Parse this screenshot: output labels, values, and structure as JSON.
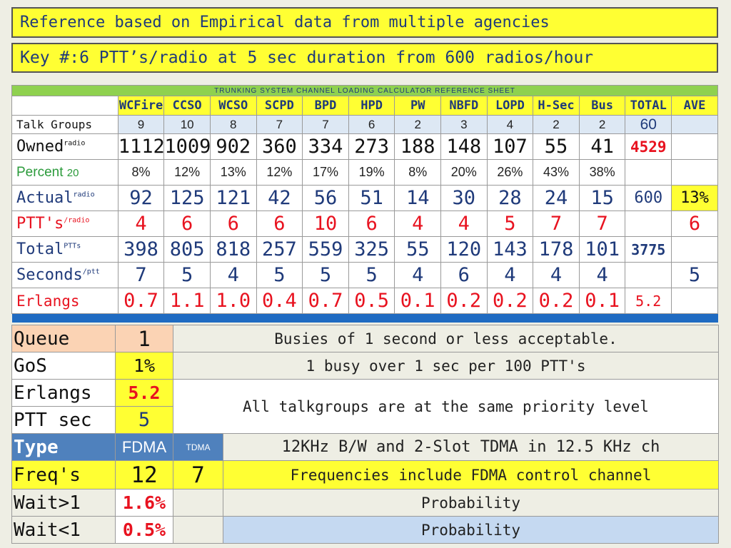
{
  "banners": {
    "line1": "Reference based on Empirical data from multiple agencies",
    "line2": "Key #:6 PTT’s/radio at 5 sec duration from 600 radios/hour"
  },
  "sheet": {
    "title": "TRUNKING SYSTEM CHANNEL LOADING CALCULATOR REFERENCE SHEET",
    "agencies": [
      "WCFire",
      "CCSO",
      "WCSO",
      "SCPD",
      "BPD",
      "HPD",
      "PW",
      "NBFD",
      "LOPD",
      "H-Sec",
      "Bus",
      "TOTAL",
      "AVE"
    ],
    "rows": {
      "talk_groups": {
        "label": "Talk Groups",
        "values": [
          "9",
          "10",
          "8",
          "7",
          "7",
          "6",
          "2",
          "3",
          "4",
          "2",
          "2"
        ],
        "total": "60",
        "ave": ""
      },
      "owned": {
        "label": "Owned",
        "unit": "radio",
        "values": [
          "1112",
          "1009",
          "902",
          "360",
          "334",
          "273",
          "188",
          "148",
          "107",
          "55",
          "41"
        ],
        "total": "4529",
        "ave": ""
      },
      "percent": {
        "label": "Percent",
        "unit": "20",
        "values": [
          "8%",
          "12%",
          "13%",
          "12%",
          "17%",
          "19%",
          "8%",
          "20%",
          "26%",
          "43%",
          "38%"
        ],
        "total": "",
        "ave": ""
      },
      "actual": {
        "label": "Actual",
        "unit": "radio",
        "values": [
          "92",
          "125",
          "121",
          "42",
          "56",
          "51",
          "14",
          "30",
          "28",
          "24",
          "15"
        ],
        "total": "600",
        "ave": "13%"
      },
      "ptts": {
        "label": "PTT's",
        "unit": "/radio",
        "values": [
          "4",
          "6",
          "6",
          "6",
          "10",
          "6",
          "4",
          "4",
          "5",
          "7",
          "7"
        ],
        "total": "",
        "ave": "6"
      },
      "total": {
        "label": "Total",
        "unit": "PTTs",
        "values": [
          "398",
          "805",
          "818",
          "257",
          "559",
          "325",
          "55",
          "120",
          "143",
          "178",
          "101"
        ],
        "total": "3775",
        "ave": ""
      },
      "seconds": {
        "label": "Seconds",
        "unit": "/ptt",
        "values": [
          "7",
          "5",
          "4",
          "5",
          "5",
          "5",
          "4",
          "6",
          "4",
          "4",
          "4"
        ],
        "total": "",
        "ave": "5"
      },
      "erlangs": {
        "label": "Erlangs",
        "values": [
          "0.7",
          "1.1",
          "1.0",
          "0.4",
          "0.7",
          "0.5",
          "0.1",
          "0.2",
          "0.2",
          "0.2",
          "0.1"
        ],
        "total": "5.2",
        "ave": ""
      }
    }
  },
  "summary": {
    "queue": {
      "label": "Queue",
      "value": "1",
      "note": "Busies of 1 second or less  acceptable."
    },
    "gos": {
      "label": "GoS",
      "value": "1%",
      "note": "1 busy over 1 sec per 100 PTT's"
    },
    "erlangs": {
      "label": "Erlangs",
      "value": "5.2"
    },
    "ptt_sec": {
      "label": "PTT sec",
      "value": "5"
    },
    "shared_note": "All talkgroups are at the same priority level",
    "type": {
      "label": "Type",
      "fdma": "FDMA",
      "tdma": "TDMA",
      "note": "12KHz B/W and 2-Slot TDMA in 12.5 KHz ch"
    },
    "freqs": {
      "label": "Freq's",
      "fdma": "12",
      "tdma": "7",
      "note": "Frequencies include FDMA control channel"
    },
    "wait_gt1": {
      "label": "Wait>1",
      "value": "1.6%",
      "note": "Probability"
    },
    "wait_lt1": {
      "label": "Wait<1",
      "value": "0.5%",
      "note": "Probability"
    }
  },
  "colors": {
    "banner_yellow": "#ffff33",
    "navy_text": "#1f3a7a",
    "red_text": "#e8121f",
    "green_text": "#2a9a3a",
    "header_green": "#8fd14f",
    "type_blue": "#4f81bd",
    "separator_blue": "#1f6bc2"
  }
}
